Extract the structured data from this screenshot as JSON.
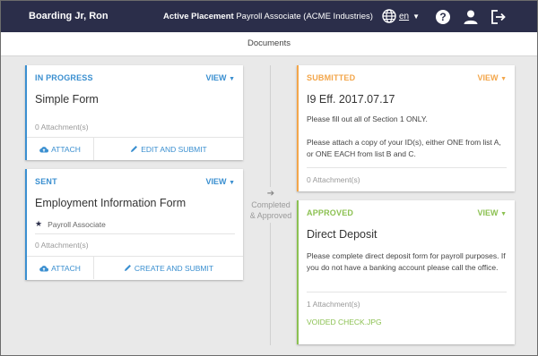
{
  "header": {
    "user_name": "Boarding Jr, Ron",
    "placement_label": "Active Placement",
    "placement_value": "Payroll Associate (ACME Industries)",
    "language": "en"
  },
  "subnav": {
    "title": "Documents"
  },
  "middle": {
    "status_line1": "Completed",
    "status_line2": "& Approved"
  },
  "cards": {
    "in_progress": {
      "status": "IN PROGRESS",
      "view": "VIEW",
      "title": "Simple Form",
      "attachments": "0 Attachment(s)",
      "action1": "ATTACH",
      "action2": "EDIT AND SUBMIT"
    },
    "sent": {
      "status": "SENT",
      "view": "VIEW",
      "title": "Employment Information Form",
      "position": "Payroll Associate",
      "attachments": "0 Attachment(s)",
      "action1": "ATTACH",
      "action2": "CREATE AND SUBMIT"
    },
    "submitted": {
      "status": "SUBMITTED",
      "view": "VIEW",
      "title": "I9 Eff. 2017.07.17",
      "desc1": "Please fill out all of Section 1 ONLY.",
      "desc2": "Please attach a copy of your ID(s), either ONE from list A, or ONE EACH from list B and C.",
      "attachments": "0 Attachment(s)"
    },
    "approved": {
      "status": "APPROVED",
      "view": "VIEW",
      "title": "Direct Deposit",
      "desc": "Please complete direct deposit form for payroll purposes. If you do not have a banking account please call the office.",
      "attachments": "1 Attachment(s)",
      "file": "VOIDED CHECK.JPG"
    }
  },
  "colors": {
    "header_bg": "#2b2e4a",
    "in_progress": "#3a8fd0",
    "submitted": "#f3a64a",
    "approved": "#8cc152"
  },
  "icons": [
    "globe-icon",
    "help-icon",
    "user-icon",
    "logout-icon",
    "cloud-upload-icon",
    "pencil-icon",
    "star-icon",
    "arrow-right-icon"
  ]
}
